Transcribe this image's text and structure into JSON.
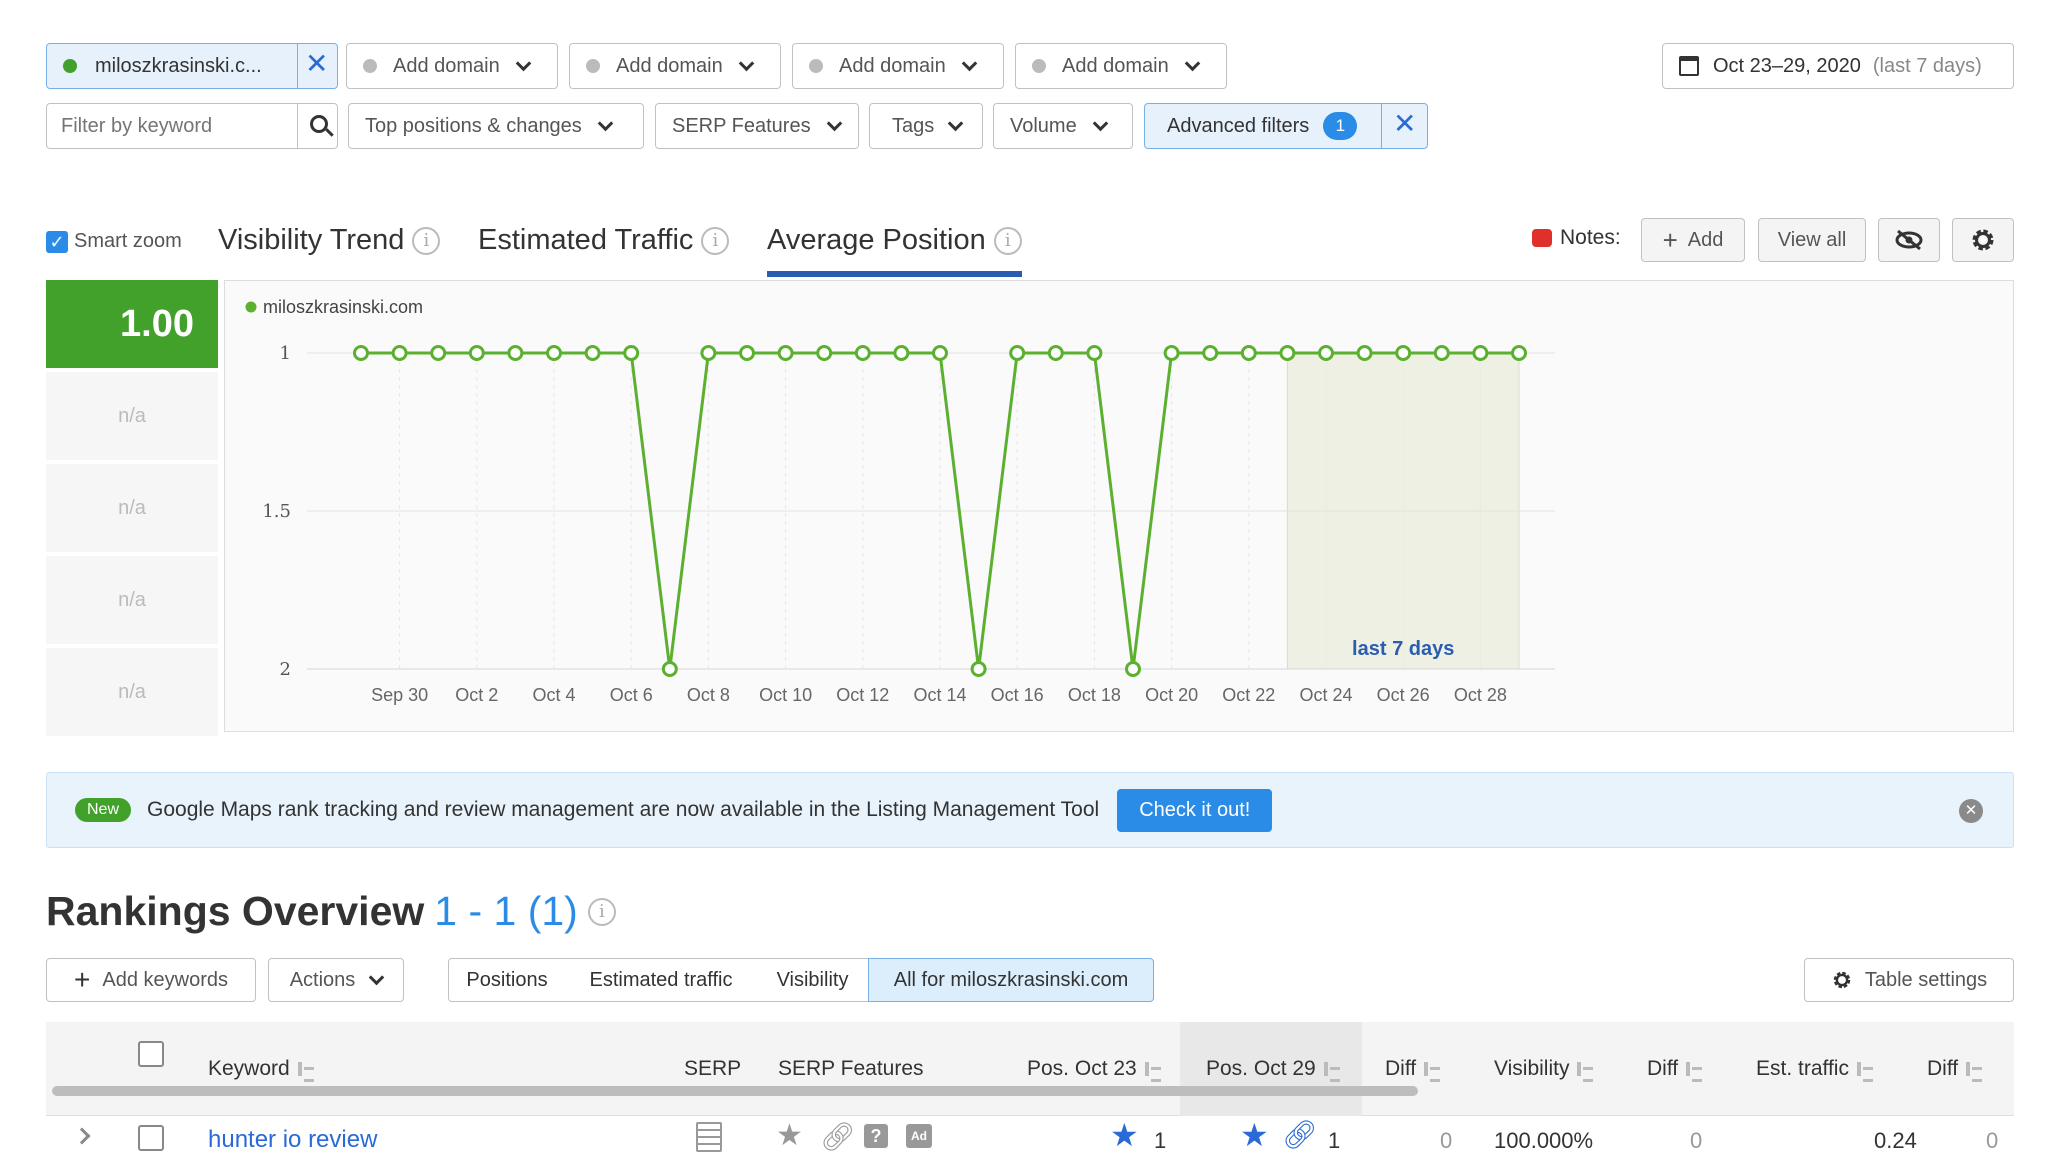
{
  "filters": {
    "domain_primary": "miloszkrasinski.c...",
    "add_domain_label": "Add domain",
    "date_range": "Oct 23–29, 2020",
    "date_hint": "(last 7 days)",
    "keyword_placeholder": "Filter by keyword",
    "top_positions": "Top positions & changes",
    "serp_features": "SERP Features",
    "tags": "Tags",
    "volume": "Volume",
    "advanced_filters": "Advanced filters",
    "advanced_count": "1"
  },
  "chart_controls": {
    "smart_zoom": "Smart zoom",
    "tabs": [
      "Visibility Trend",
      "Estimated Traffic",
      "Average Position"
    ],
    "active_tab": "Average Position",
    "notes_label": "Notes:",
    "add_label": "Add",
    "view_all_label": "View all"
  },
  "score_panel": {
    "main_value": "1.00",
    "rows": [
      "n/a",
      "n/a",
      "n/a",
      "n/a"
    ]
  },
  "chart_data": {
    "type": "line",
    "legend": "miloszkrasinski.com",
    "series": [
      {
        "name": "miloszkrasinski.com",
        "x": [
          "Sep 29",
          "Sep 30",
          "Oct 1",
          "Oct 2",
          "Oct 3",
          "Oct 4",
          "Oct 5",
          "Oct 6",
          "Oct 7",
          "Oct 8",
          "Oct 9",
          "Oct 10",
          "Oct 11",
          "Oct 12",
          "Oct 13",
          "Oct 14",
          "Oct 15",
          "Oct 16",
          "Oct 17",
          "Oct 18",
          "Oct 19",
          "Oct 20",
          "Oct 21",
          "Oct 22",
          "Oct 23",
          "Oct 24",
          "Oct 25",
          "Oct 26",
          "Oct 27",
          "Oct 28",
          "Oct 29"
        ],
        "values": [
          1,
          1,
          1,
          1,
          1,
          1,
          1,
          1,
          2,
          1,
          1,
          1,
          1,
          1,
          1,
          1,
          2,
          1,
          1,
          1,
          2,
          1,
          1,
          1,
          1,
          1,
          1,
          1,
          1,
          1,
          1
        ]
      }
    ],
    "x_ticks": [
      "Sep 30",
      "Oct 2",
      "Oct 4",
      "Oct 6",
      "Oct 8",
      "Oct 10",
      "Oct 12",
      "Oct 14",
      "Oct 16",
      "Oct 18",
      "Oct 20",
      "Oct 22",
      "Oct 24",
      "Oct 26",
      "Oct 28"
    ],
    "y_ticks": [
      "1",
      "1.5",
      "2"
    ],
    "ylim": [
      1,
      2
    ],
    "y_reversed": true,
    "highlight_range": [
      "Oct 23",
      "Oct 29"
    ],
    "highlight_label": "last 7 days",
    "line_color": "#5cb030",
    "grid": true
  },
  "banner": {
    "badge": "New",
    "text": "Google Maps rank tracking and review management are now available in the Listing Management Tool",
    "cta": "Check it out!"
  },
  "rankings": {
    "title": "Rankings Overview",
    "count": "1 - 1 (1)",
    "add_keywords": "Add keywords",
    "actions": "Actions",
    "views": [
      "Positions",
      "Estimated traffic",
      "Visibility",
      "All for miloszkrasinski.com"
    ],
    "table_settings": "Table settings",
    "columns": [
      "Keyword",
      "SERP",
      "SERP Features",
      "Pos. Oct 23",
      "Pos. Oct 29",
      "Diff",
      "Visibility",
      "Diff",
      "Est. traffic",
      "Diff"
    ],
    "rows": [
      {
        "keyword": "hunter io review",
        "pos_oct23": "1",
        "pos_oct29": "1",
        "diff1": "0",
        "visibility": "100.000%",
        "diff2": "0",
        "est_traffic": "0.24",
        "diff3": "0"
      }
    ]
  },
  "colors": {
    "accent_blue": "#2a6ad6",
    "green": "#5cb030",
    "score_green": "#41a12b",
    "banner_bg": "#e8f3fc"
  }
}
